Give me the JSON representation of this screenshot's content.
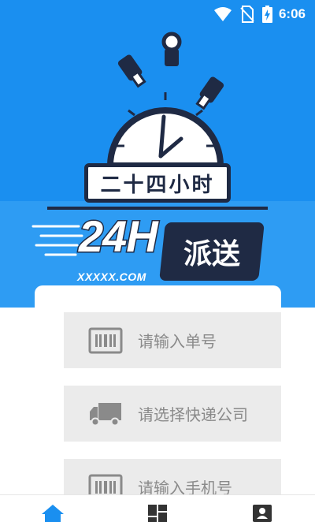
{
  "status_bar": {
    "time": "6:06",
    "icons": [
      "wifi-icon",
      "no-sim-icon",
      "battery-charging-icon"
    ]
  },
  "banner": {
    "title_cn": "二十四小时",
    "brand_24h": "24H",
    "brand_cn": "派送",
    "domain": "XXXXX.COM",
    "colors": {
      "background": "#1a8ff0",
      "dark": "#1f2a44"
    }
  },
  "form": {
    "fields": [
      {
        "label": "请输入单号",
        "icon": "barcode-icon"
      },
      {
        "label": "请选择快递公司",
        "icon": "truck-icon"
      },
      {
        "label": "请输入手机号",
        "icon": "barcode-icon"
      }
    ]
  },
  "bottom_nav": {
    "items": [
      {
        "icon": "home-icon",
        "active": true
      },
      {
        "icon": "dashboard-icon",
        "active": false
      },
      {
        "icon": "profile-icon",
        "active": false
      }
    ],
    "active_color": "#1a8ff0",
    "inactive_color": "#333333"
  }
}
